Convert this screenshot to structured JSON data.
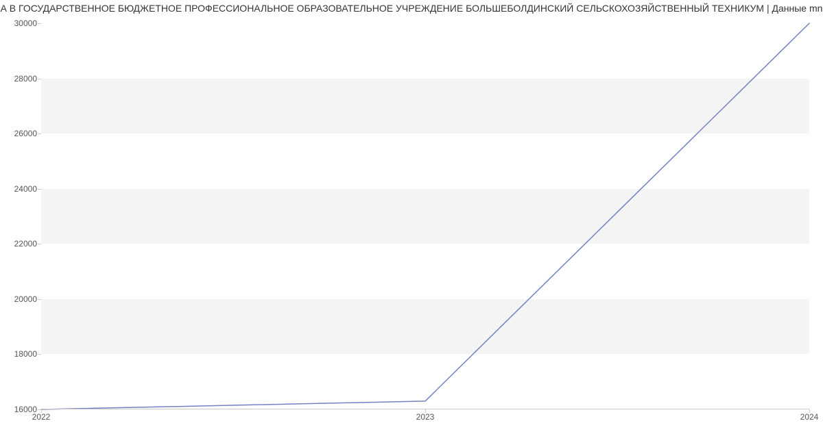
{
  "title": "А В ГОСУДАРСТВЕННОЕ БЮДЖЕТНОЕ ПРОФЕССИОНАЛЬНОЕ ОБРАЗОВАТЕЛЬНОЕ УЧРЕЖДЕНИЕ БОЛЬШЕБОЛДИНСКИЙ СЕЛЬСКОХОЗЯЙСТВЕННЫЙ ТЕХНИКУМ | Данные mn",
  "chart_data": {
    "type": "line",
    "x": [
      2022,
      2023,
      2024
    ],
    "values": [
      16000,
      16300,
      30000
    ],
    "title": "А В ГОСУДАРСТВЕННОЕ БЮДЖЕТНОЕ ПРОФЕССИОНАЛЬНОЕ ОБРАЗОВАТЕЛЬНОЕ УЧРЕЖДЕНИЕ БОЛЬШЕБОЛДИНСКИЙ СЕЛЬСКОХОЗЯЙСТВЕННЫЙ ТЕХНИКУМ | Данные mn",
    "xlabel": "",
    "ylabel": "",
    "xticks": [
      2022,
      2023,
      2024
    ],
    "yticks": [
      16000,
      18000,
      20000,
      22000,
      24000,
      26000,
      28000,
      30000
    ],
    "xlim": [
      2022,
      2024
    ],
    "ylim": [
      16000,
      30000
    ],
    "line_color": "#7181c3",
    "grid": false,
    "alternating_bands": true
  }
}
